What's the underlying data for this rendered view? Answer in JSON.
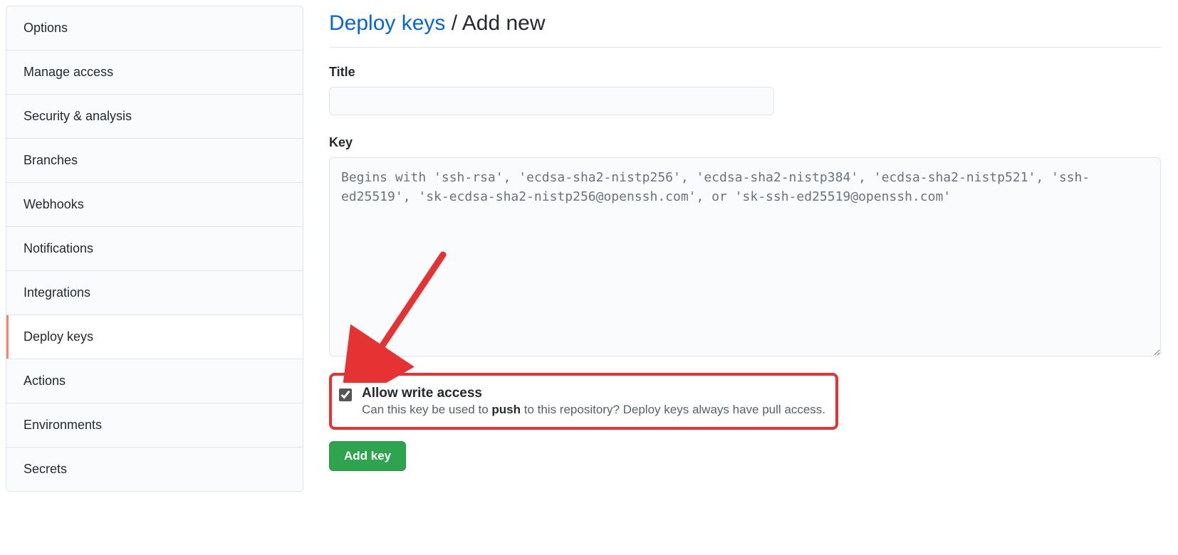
{
  "sidebar": {
    "items": [
      {
        "label": "Options"
      },
      {
        "label": "Manage access"
      },
      {
        "label": "Security & analysis"
      },
      {
        "label": "Branches"
      },
      {
        "label": "Webhooks"
      },
      {
        "label": "Notifications"
      },
      {
        "label": "Integrations"
      },
      {
        "label": "Deploy keys"
      },
      {
        "label": "Actions"
      },
      {
        "label": "Environments"
      },
      {
        "label": "Secrets"
      }
    ]
  },
  "header": {
    "link": "Deploy keys",
    "sep": " / ",
    "current": "Add new"
  },
  "form": {
    "title_label": "Title",
    "title_value": "",
    "key_label": "Key",
    "key_value": "",
    "key_placeholder": "Begins with 'ssh-rsa', 'ecdsa-sha2-nistp256', 'ecdsa-sha2-nistp384', 'ecdsa-sha2-nistp521', 'ssh-ed25519', 'sk-ecdsa-sha2-nistp256@openssh.com', or 'sk-ssh-ed25519@openssh.com'",
    "write_access_label": "Allow write access",
    "write_access_desc_pre": "Can this key be used to ",
    "write_access_desc_strong": "push",
    "write_access_desc_post": " to this repository? Deploy keys always have pull access.",
    "submit_label": "Add key"
  }
}
